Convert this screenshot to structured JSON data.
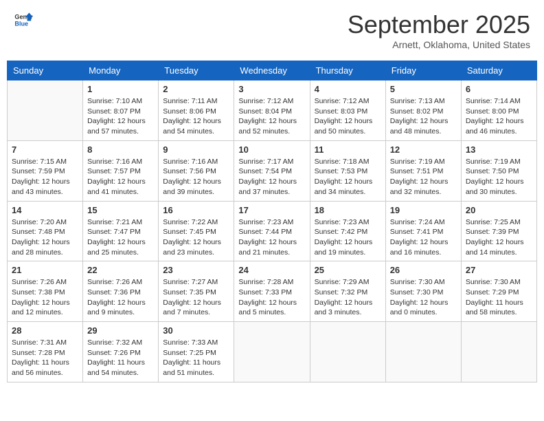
{
  "header": {
    "logo_general": "General",
    "logo_blue": "Blue",
    "title": "September 2025",
    "subtitle": "Arnett, Oklahoma, United States"
  },
  "weekdays": [
    "Sunday",
    "Monday",
    "Tuesday",
    "Wednesday",
    "Thursday",
    "Friday",
    "Saturday"
  ],
  "weeks": [
    [
      {
        "day": "",
        "info": ""
      },
      {
        "day": "1",
        "info": "Sunrise: 7:10 AM\nSunset: 8:07 PM\nDaylight: 12 hours\nand 57 minutes."
      },
      {
        "day": "2",
        "info": "Sunrise: 7:11 AM\nSunset: 8:06 PM\nDaylight: 12 hours\nand 54 minutes."
      },
      {
        "day": "3",
        "info": "Sunrise: 7:12 AM\nSunset: 8:04 PM\nDaylight: 12 hours\nand 52 minutes."
      },
      {
        "day": "4",
        "info": "Sunrise: 7:12 AM\nSunset: 8:03 PM\nDaylight: 12 hours\nand 50 minutes."
      },
      {
        "day": "5",
        "info": "Sunrise: 7:13 AM\nSunset: 8:02 PM\nDaylight: 12 hours\nand 48 minutes."
      },
      {
        "day": "6",
        "info": "Sunrise: 7:14 AM\nSunset: 8:00 PM\nDaylight: 12 hours\nand 46 minutes."
      }
    ],
    [
      {
        "day": "7",
        "info": "Sunrise: 7:15 AM\nSunset: 7:59 PM\nDaylight: 12 hours\nand 43 minutes."
      },
      {
        "day": "8",
        "info": "Sunrise: 7:16 AM\nSunset: 7:57 PM\nDaylight: 12 hours\nand 41 minutes."
      },
      {
        "day": "9",
        "info": "Sunrise: 7:16 AM\nSunset: 7:56 PM\nDaylight: 12 hours\nand 39 minutes."
      },
      {
        "day": "10",
        "info": "Sunrise: 7:17 AM\nSunset: 7:54 PM\nDaylight: 12 hours\nand 37 minutes."
      },
      {
        "day": "11",
        "info": "Sunrise: 7:18 AM\nSunset: 7:53 PM\nDaylight: 12 hours\nand 34 minutes."
      },
      {
        "day": "12",
        "info": "Sunrise: 7:19 AM\nSunset: 7:51 PM\nDaylight: 12 hours\nand 32 minutes."
      },
      {
        "day": "13",
        "info": "Sunrise: 7:19 AM\nSunset: 7:50 PM\nDaylight: 12 hours\nand 30 minutes."
      }
    ],
    [
      {
        "day": "14",
        "info": "Sunrise: 7:20 AM\nSunset: 7:48 PM\nDaylight: 12 hours\nand 28 minutes."
      },
      {
        "day": "15",
        "info": "Sunrise: 7:21 AM\nSunset: 7:47 PM\nDaylight: 12 hours\nand 25 minutes."
      },
      {
        "day": "16",
        "info": "Sunrise: 7:22 AM\nSunset: 7:45 PM\nDaylight: 12 hours\nand 23 minutes."
      },
      {
        "day": "17",
        "info": "Sunrise: 7:23 AM\nSunset: 7:44 PM\nDaylight: 12 hours\nand 21 minutes."
      },
      {
        "day": "18",
        "info": "Sunrise: 7:23 AM\nSunset: 7:42 PM\nDaylight: 12 hours\nand 19 minutes."
      },
      {
        "day": "19",
        "info": "Sunrise: 7:24 AM\nSunset: 7:41 PM\nDaylight: 12 hours\nand 16 minutes."
      },
      {
        "day": "20",
        "info": "Sunrise: 7:25 AM\nSunset: 7:39 PM\nDaylight: 12 hours\nand 14 minutes."
      }
    ],
    [
      {
        "day": "21",
        "info": "Sunrise: 7:26 AM\nSunset: 7:38 PM\nDaylight: 12 hours\nand 12 minutes."
      },
      {
        "day": "22",
        "info": "Sunrise: 7:26 AM\nSunset: 7:36 PM\nDaylight: 12 hours\nand 9 minutes."
      },
      {
        "day": "23",
        "info": "Sunrise: 7:27 AM\nSunset: 7:35 PM\nDaylight: 12 hours\nand 7 minutes."
      },
      {
        "day": "24",
        "info": "Sunrise: 7:28 AM\nSunset: 7:33 PM\nDaylight: 12 hours\nand 5 minutes."
      },
      {
        "day": "25",
        "info": "Sunrise: 7:29 AM\nSunset: 7:32 PM\nDaylight: 12 hours\nand 3 minutes."
      },
      {
        "day": "26",
        "info": "Sunrise: 7:30 AM\nSunset: 7:30 PM\nDaylight: 12 hours\nand 0 minutes."
      },
      {
        "day": "27",
        "info": "Sunrise: 7:30 AM\nSunset: 7:29 PM\nDaylight: 11 hours\nand 58 minutes."
      }
    ],
    [
      {
        "day": "28",
        "info": "Sunrise: 7:31 AM\nSunset: 7:28 PM\nDaylight: 11 hours\nand 56 minutes."
      },
      {
        "day": "29",
        "info": "Sunrise: 7:32 AM\nSunset: 7:26 PM\nDaylight: 11 hours\nand 54 minutes."
      },
      {
        "day": "30",
        "info": "Sunrise: 7:33 AM\nSunset: 7:25 PM\nDaylight: 11 hours\nand 51 minutes."
      },
      {
        "day": "",
        "info": ""
      },
      {
        "day": "",
        "info": ""
      },
      {
        "day": "",
        "info": ""
      },
      {
        "day": "",
        "info": ""
      }
    ]
  ]
}
